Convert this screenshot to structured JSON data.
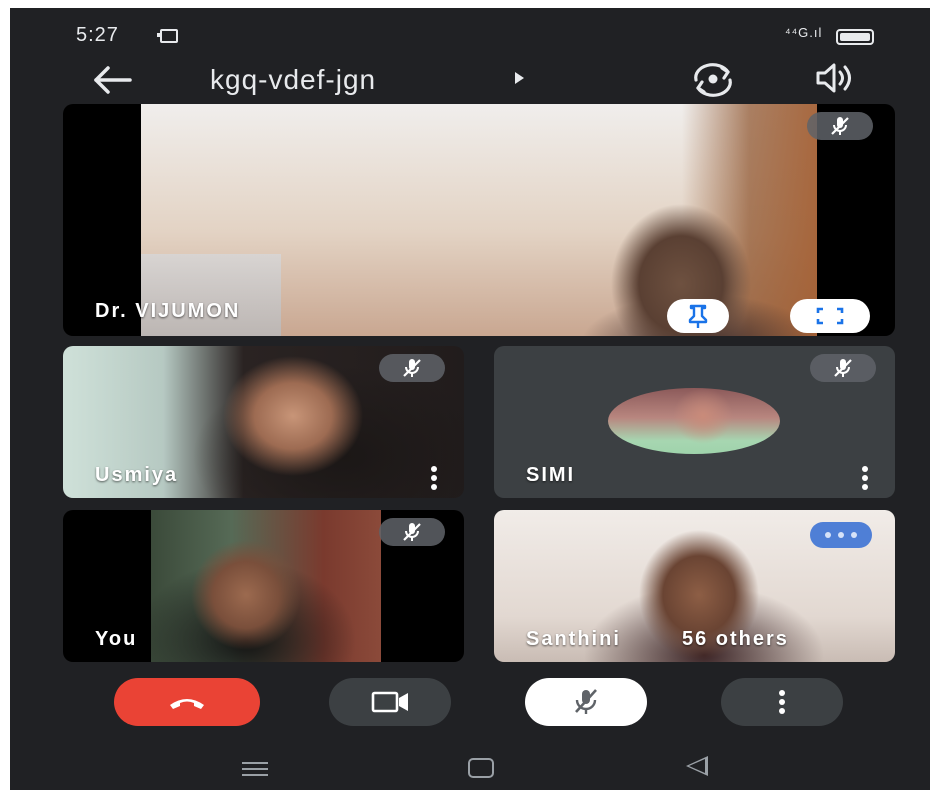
{
  "status_bar": {
    "time": "5:27",
    "signal": "⁴⁴G.ıl",
    "icons": [
      "cast-icon",
      "signal-icon",
      "battery-icon"
    ]
  },
  "top_bar": {
    "meeting_code": "kgq-vdef-jgn",
    "icons": [
      "back-arrow-icon",
      "play-arrow-icon",
      "switch-camera-icon",
      "speaker-icon"
    ]
  },
  "participants": {
    "main": {
      "name": "Dr. VIJUMON",
      "muted": true
    },
    "usmiya": {
      "name": "Usmiya",
      "muted": true
    },
    "simi": {
      "name": "SIMI",
      "muted": true
    },
    "you": {
      "name": "You",
      "muted": true
    },
    "others": {
      "name": "Santhini",
      "count_label": "56 others"
    }
  },
  "controls": {
    "icons": [
      "end-call-icon",
      "video-camera-icon",
      "mic-off-icon",
      "more-vert-icon"
    ]
  },
  "colors": {
    "background": "#202124",
    "tile_dark": "#3c4043",
    "end_call": "#ea4335",
    "accent_blue": "#1a73e8",
    "speaking_badge": "#4f7fd6"
  }
}
